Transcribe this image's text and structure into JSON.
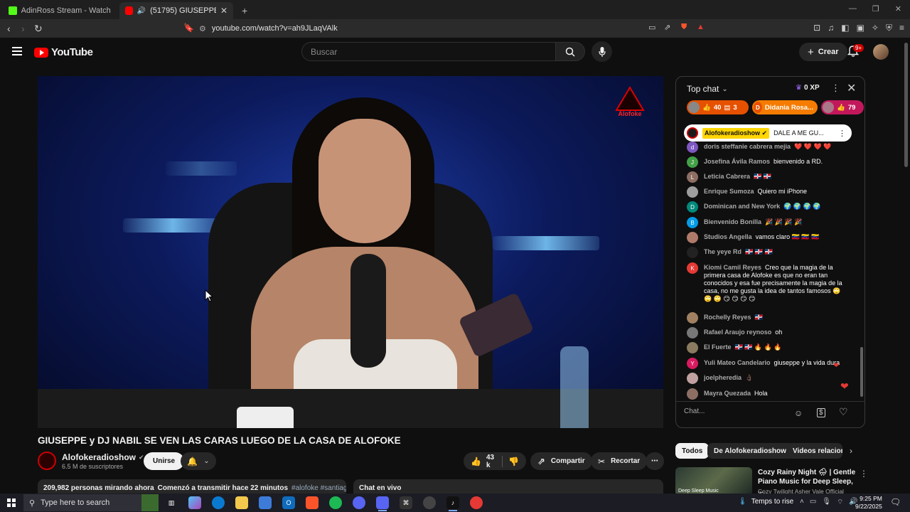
{
  "browser": {
    "tabs": [
      {
        "title": "AdinRoss Stream - Watch Live on Kic",
        "color": "#53fc18"
      },
      {
        "title": "(51795) GIUSEPPE y DJ NABIL",
        "color": "#ff0000"
      }
    ],
    "new_tab": "+",
    "url": "youtube.com/watch?v=ah9JLaqVAlk",
    "window_controls": [
      "—",
      "❐",
      "✕"
    ]
  },
  "header": {
    "logo_text": "YouTube",
    "search_placeholder": "Buscar",
    "create_label": "Crear",
    "notifications_badge": "9+"
  },
  "video": {
    "title": "GIUSEPPE y DJ NABIL SE VEN LAS CARAS LUEGO DE LA CASA DE ALOFOKE",
    "watermark": "Alofoke"
  },
  "channel": {
    "name": "Alofokeradioshow",
    "subscribers": "6.5 M de suscriptores",
    "join_label": "Unirse"
  },
  "actions": {
    "likes": "43 k",
    "share_label": "Compartir",
    "clip_label": "Recortar"
  },
  "description": {
    "viewers": "209,982 personas mirando ahora",
    "started": "Comenzó a transmitir hace 22 minutos",
    "hashtags": "#alofoke #santiagomatias"
  },
  "live_chat_label": "Chat en vivo",
  "chat": {
    "header": "Top chat",
    "xp": "0 XP",
    "tickers": [
      {
        "likes": "40",
        "count": "3",
        "bg": "#e65100",
        "av": "#888"
      },
      {
        "initial": "D",
        "name": "Didania Rosa...",
        "bg": "#f57c00",
        "av": "#e65100"
      },
      {
        "likes": "79",
        "bg": "#c2185b",
        "av": "#aa7788"
      }
    ],
    "pinned": {
      "author": "Alofokeradioshow",
      "text": "DALE A ME GU..."
    },
    "messages": [
      {
        "author": "doris steffanie cabrera mejia",
        "text": "❤️ ❤️ ❤️ ❤️",
        "initial": "d",
        "color": "#7e57c2"
      },
      {
        "author": "Josefina Ávila Ramos",
        "text": "bienvenido a RD.",
        "initial": "J",
        "color": "#43a047"
      },
      {
        "author": "Leticia Cabrera",
        "text": "🇩🇴 🇩🇴",
        "initial": "L",
        "color": "#8d6e63"
      },
      {
        "author": "Enrique Sumoza",
        "text": "Quiero mi iPhone",
        "initial": "",
        "color": "#9e9e9e"
      },
      {
        "author": "Dominican and New York",
        "text": "🌍 🌍 🌍 🌍",
        "initial": "D",
        "color": "#00897b"
      },
      {
        "author": "Bienvenido Bonilla",
        "text": "🎉 🎉 🎉 🎉",
        "initial": "B",
        "color": "#039be5"
      },
      {
        "author": "Studios Angella",
        "text": "vamos claro 🇻🇪 🇻🇪 🇻🇪",
        "initial": "",
        "color": "#b07a6a"
      },
      {
        "author": "The yeye Rd",
        "text": "🇩🇴 🇩🇴 🇩🇴",
        "initial": "",
        "color": "#222222"
      },
      {
        "author": "Kiomi Camil Reyes",
        "text": "Creo que la magia de la primera casa de Alofoke es que no eran tan conocidos y esa fue precisamente la magia de la casa, no me gusta la idea de tantos famosos 🙄 🙄 🙄 😏 😏 😏 😏",
        "initial": "K",
        "color": "#e53935"
      },
      {
        "author": "Rochelly Reyes",
        "text": "🇩🇴",
        "initial": "",
        "color": "#a08060"
      },
      {
        "author": "Rafael Araujo reynoso",
        "text": "oh",
        "initial": "",
        "color": "#777777"
      },
      {
        "author": "El Fuerte",
        "text": "🇩🇴 🇩🇴 🔥 🔥 🔥",
        "initial": "",
        "color": "#8a7a60"
      },
      {
        "author": "Yuli Mateo Candelario",
        "text": "giuseppe y la vida dura",
        "initial": "Y",
        "color": "#d81b60"
      },
      {
        "author": "joelpheredia",
        "text": "👌🏿",
        "initial": "",
        "color": "#c0a0a0"
      },
      {
        "author": "Mayra Quezada",
        "text": "Hola",
        "initial": "",
        "color": "#8d6e63"
      }
    ],
    "input_placeholder": "Chat..."
  },
  "chips": [
    "Todos",
    "De Alofokeradioshow",
    "Videos relacion"
  ],
  "recommendation": {
    "title": "Cozy Rainy Night 🌧 | Gentle Piano Music for Deep Sleep, ...",
    "channel": "Cozy Twilight Asher Vale Official",
    "thumb_label": "Deep Sleep Music"
  },
  "taskbar": {
    "search_placeholder": "Type here to search",
    "weather": "Temps to rise",
    "time": "9:25 PM",
    "date": "9/22/2025"
  }
}
